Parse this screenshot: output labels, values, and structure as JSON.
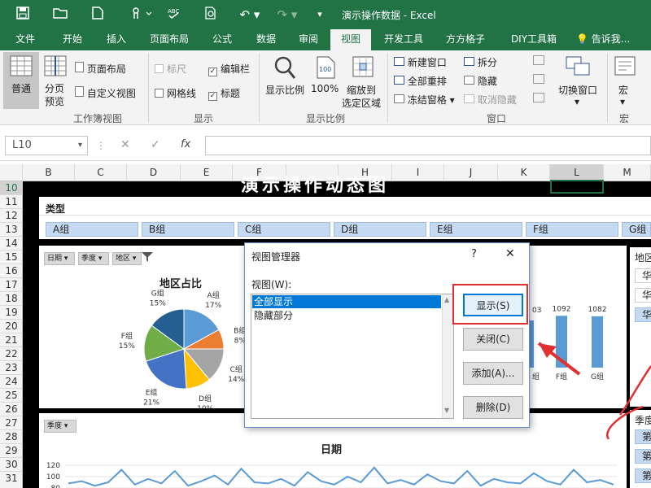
{
  "window": {
    "title": "演示操作数据 - Excel"
  },
  "quick_access": {
    "undo": "↶",
    "redo": "↷"
  },
  "tabs": [
    "文件",
    "开始",
    "插入",
    "页面布局",
    "公式",
    "数据",
    "审阅",
    "视图",
    "开发工具",
    "方方格子",
    "DIY工具箱"
  ],
  "tellme": "告诉我...",
  "ribbon": {
    "normal": "普通",
    "page_break_1": "分页",
    "page_break_2": "预览",
    "page_layout": "页面布局",
    "custom_view": "自定义视图",
    "group_workbook_view": "工作簿视图",
    "ruler": "标尺",
    "gridlines": "网格线",
    "formula_bar": "编辑栏",
    "headings": "标题",
    "group_show": "显示",
    "zoom": "显示比例",
    "zoom100": "100%",
    "zoom100_icon": "100",
    "zoom_sel_1": "缩放到",
    "zoom_sel_2": "选定区域",
    "group_zoom": "显示比例",
    "new_window": "新建窗口",
    "arrange_all": "全部重排",
    "freeze": "冻结窗格",
    "split": "拆分",
    "hide": "隐藏",
    "unhide": "取消隐藏",
    "group_window": "窗口",
    "switch_window": "切换窗口",
    "macro": "宏",
    "group_macro": "宏"
  },
  "formula_bar": {
    "name_box": "L10",
    "fx": "fx",
    "cancel": "✕",
    "enter": "✓",
    "content": ""
  },
  "columns": [
    "B",
    "C",
    "D",
    "E",
    "F",
    "H",
    "I",
    "J",
    "K",
    "L",
    "M"
  ],
  "rows": [
    "10",
    "11",
    "12",
    "13",
    "14",
    "15",
    "16",
    "17",
    "18",
    "19",
    "20",
    "21",
    "22",
    "23",
    "24",
    "25",
    "26",
    "27",
    "28",
    "29",
    "30",
    "31"
  ],
  "dashboard": {
    "title": "演示操作动态图",
    "type_label": "类型",
    "groups": [
      "A组",
      "B组",
      "C组",
      "D组",
      "E组",
      "F组",
      "G组"
    ],
    "filters": [
      "日期",
      "季度",
      "地区"
    ],
    "region_label": "地区",
    "region_items": [
      "华",
      "华",
      "华"
    ],
    "quarter_label": "季度",
    "quarter_items": [
      "第",
      "第",
      "第"
    ],
    "quarter_filter": "季度",
    "line_title": "日期",
    "line_ticks": [
      "120",
      "100",
      "80"
    ]
  },
  "chart_data": [
    {
      "type": "pie",
      "title": "地区占比",
      "categories": [
        "A组",
        "B组",
        "C组",
        "D组",
        "E组",
        "F组",
        "G组"
      ],
      "values": [
        17,
        8,
        14,
        10,
        21,
        15,
        15
      ],
      "colors": [
        "#5b9bd5",
        "#ed7d31",
        "#a5a5a5",
        "#ffc000",
        "#4472c4",
        "#70ad47",
        "#255e91"
      ]
    },
    {
      "type": "bar",
      "categories": [
        "F组",
        "G组"
      ],
      "values": [
        1092,
        1082
      ],
      "partial_value_label": "03",
      "partial_category_label": "组",
      "color": "#5b9bd5"
    },
    {
      "type": "line",
      "title": "日期",
      "ylim": [
        80,
        120
      ],
      "y_ticks": [
        120,
        100,
        80
      ],
      "values": [
        88,
        92,
        84,
        90,
        112,
        86,
        96,
        88,
        110,
        84,
        92,
        102,
        86,
        114,
        90,
        88,
        96,
        84,
        108,
        92,
        86,
        100,
        90,
        116,
        88,
        94,
        86,
        104,
        92,
        88,
        110,
        84,
        96,
        90,
        88,
        106,
        92,
        86,
        112,
        90,
        94,
        86
      ]
    }
  ],
  "dialog": {
    "title": "视图管理器",
    "help": "?",
    "close": "✕",
    "list_label": "视图(W):",
    "views": [
      "全部显示",
      "隐藏部分"
    ],
    "btn_show": "显示(S)",
    "btn_close": "关闭(C)",
    "btn_add": "添加(A)...",
    "btn_delete": "删除(D)"
  },
  "colors": {
    "excel_green": "#217346",
    "selection_blue": "#0078d7",
    "highlight_red": "#e03030",
    "slicer_blue": "#c5d9f1"
  }
}
